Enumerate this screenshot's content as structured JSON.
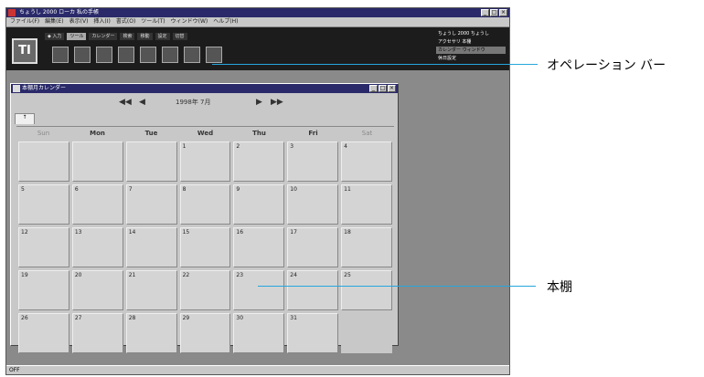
{
  "app": {
    "title": "ちょうし 2000 ローカ 私の手帳",
    "menu": [
      "ファイル(F)",
      "編集(E)",
      "表示(V)",
      "挿入(I)",
      "書式(O)",
      "ツール(T)",
      "ウィンドウ(W)",
      "ヘルプ(H)"
    ]
  },
  "opbar": {
    "logo": "TI",
    "tabs": [
      "◆ 入力",
      "ツール",
      "カレンダー",
      "検索",
      "移動",
      "設定",
      "切替"
    ],
    "status": [
      "ちょうし 2000 ちょうし",
      "アクセサリ 本棚",
      "カレンダー ウィンドウ",
      "休日設定"
    ]
  },
  "calendar": {
    "window_title": "本棚月カレンダー",
    "month_label": "1998年 7月",
    "prev_nav": [
      "◀◀",
      "◀"
    ],
    "next_nav": [
      "▶",
      "▶▶"
    ],
    "spine_tab": "↑",
    "weekdays": [
      "Sun",
      "Mon",
      "Tue",
      "Wed",
      "Thu",
      "Fri",
      "Sat"
    ],
    "weeks": [
      [
        "",
        "",
        "",
        "1",
        "2",
        "3",
        "4"
      ],
      [
        "5",
        "6",
        "7",
        "8",
        "9",
        "10",
        "11"
      ],
      [
        "12",
        "13",
        "14",
        "15",
        "16",
        "17",
        "18"
      ],
      [
        "19",
        "20",
        "21",
        "22",
        "23",
        "24",
        "25"
      ],
      [
        "26",
        "27",
        "28",
        "29",
        "30",
        "31",
        ""
      ]
    ]
  },
  "statusbar": {
    "text": "OFF"
  },
  "callouts": {
    "operation_bar": "オペレーション バー",
    "bookshelf": "本棚"
  },
  "colors": {
    "callout_line": "#26a6dd",
    "titlebar": "#2a2a6a"
  }
}
